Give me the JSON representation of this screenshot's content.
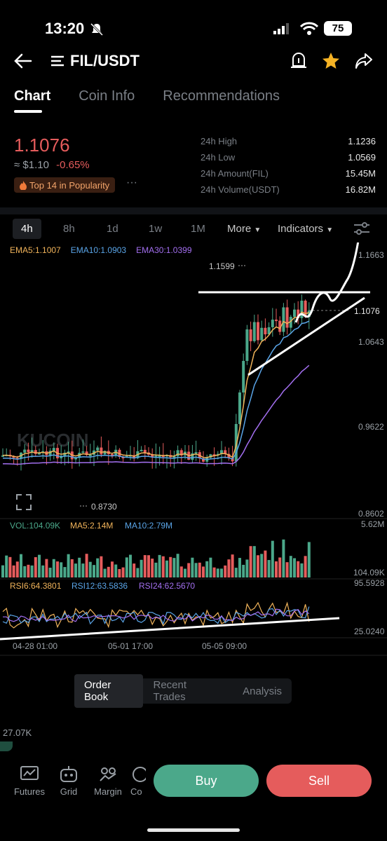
{
  "status": {
    "time": "13:20",
    "battery": "75"
  },
  "header": {
    "pair": "FIL/USDT"
  },
  "tabs": [
    "Chart",
    "Coin Info",
    "Recommendations"
  ],
  "ticker": {
    "last_price": "1.1076",
    "usd_price": "≈ $1.10",
    "change": "-0.65%",
    "popularity": "Top 14 in Popularity",
    "more": "···"
  },
  "stats": [
    {
      "label": "24h High",
      "value": "1.1236"
    },
    {
      "label": "24h Low",
      "value": "1.0569"
    },
    {
      "label": "24h Amount(FIL)",
      "value": "15.45M"
    },
    {
      "label": "24h Volume(USDT)",
      "value": "16.82M"
    }
  ],
  "intervals": [
    "4h",
    "8h",
    "1d",
    "1w",
    "1M",
    "More",
    "Indicators"
  ],
  "indicators": {
    "ema5": "EMA5:1.1007",
    "ema10": "EMA10:1.0903",
    "ema30": "EMA30:1.0399",
    "vol": "VOL:104.09K",
    "ma5": "MA5:2.14M",
    "ma10": "MA10:2.79M",
    "rsi6": "RSI6:64.3801",
    "rsi12": "RSI12:63.5836",
    "rsi24": "RSI24:62.5670"
  },
  "chart_labels": {
    "high_mark": "1.1599",
    "low_mark": "0.8730",
    "y_ticks": [
      "1.1663",
      "1.1076",
      "1.0643",
      "0.9622",
      "0.8602"
    ],
    "vol_top": "5.62M",
    "vol_bottom": "104.09K",
    "rsi_top": "95.5928",
    "rsi_bottom": "25.0240",
    "x_ticks": [
      "04-28 01:00",
      "05-01 17:00",
      "05-05 09:00"
    ],
    "watermark": "KUCOIN"
  },
  "colors": {
    "up": "#4ba88a",
    "down": "#e55c5c",
    "ema5": "#f0b35a",
    "ema10": "#5aa5e8",
    "ema30": "#a36ff0"
  },
  "subtabs": [
    "Order Book",
    "Recent Trades",
    "Analysis"
  ],
  "depth_label": "27.07K",
  "bottom_nav": [
    {
      "label": "Futures",
      "icon": "futures-icon"
    },
    {
      "label": "Grid",
      "icon": "grid-bot-icon"
    },
    {
      "label": "Margin",
      "icon": "margin-icon"
    },
    {
      "label": "Co",
      "icon": "copy-icon"
    }
  ],
  "actions": {
    "buy": "Buy",
    "sell": "Sell"
  }
}
